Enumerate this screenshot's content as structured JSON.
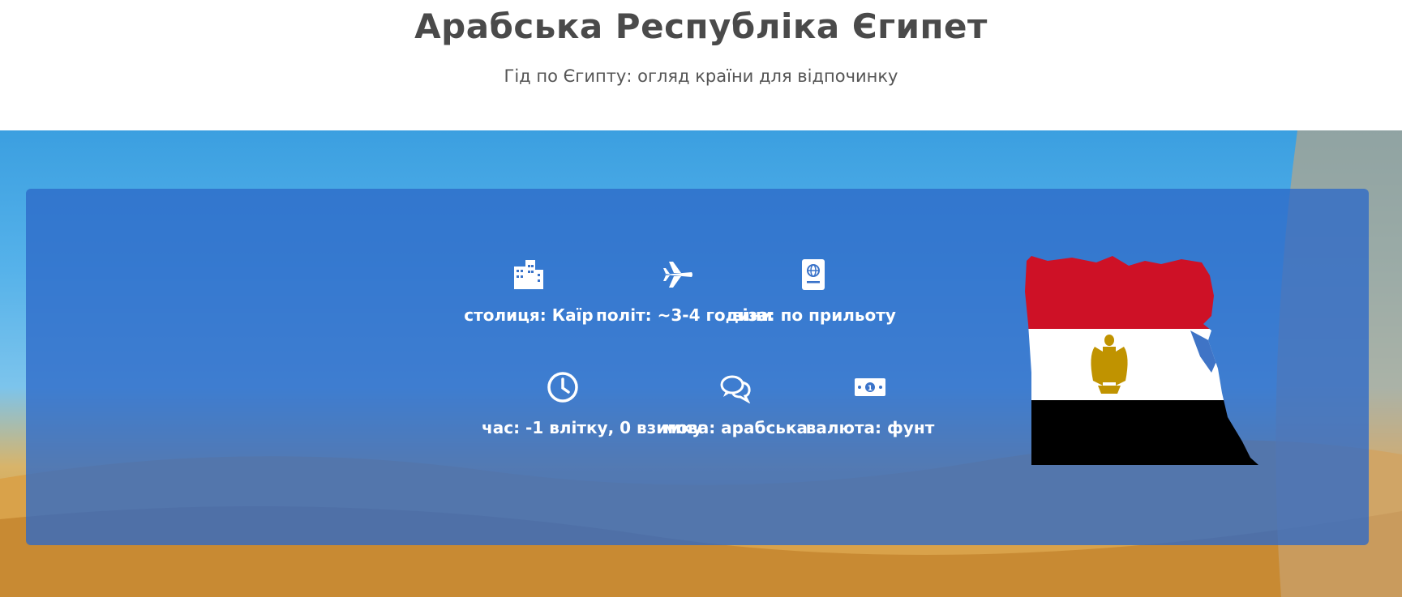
{
  "header": {
    "title": "Арабська Республіка Єгипет",
    "subtitle": "Гід по Єгипту: огляд країни для відпочинку"
  },
  "features": [
    {
      "icon": "city-icon",
      "label": "столиця: Каїр"
    },
    {
      "icon": "airplane-icon",
      "label": "політ: ~3-4 години"
    },
    {
      "icon": "passport-icon",
      "label": "віза: по прильоту"
    },
    {
      "icon": "clock-icon",
      "label": "час: -1 влітку, 0 взимку"
    },
    {
      "icon": "chat-bubbles-icon",
      "label": "мова: арабська"
    },
    {
      "icon": "money-icon",
      "label": "валюта: фунт"
    }
  ],
  "colors": {
    "panel": "#2d69c8",
    "flag_red": "#ce1126",
    "flag_white": "#ffffff",
    "flag_black": "#000000",
    "eagle": "#c09300"
  }
}
